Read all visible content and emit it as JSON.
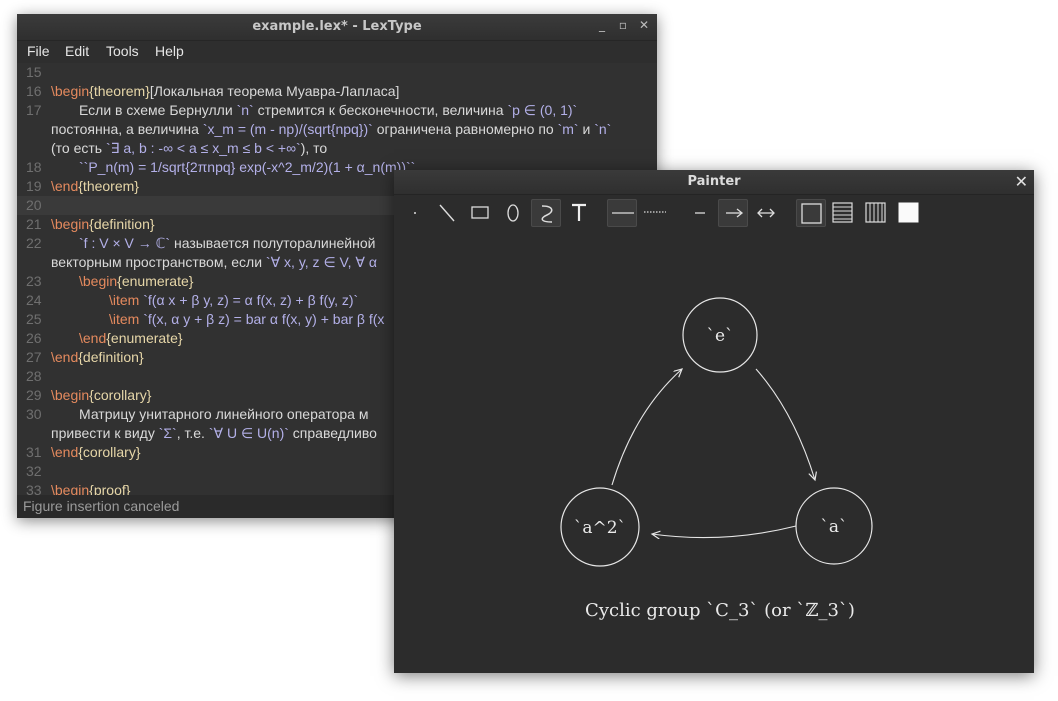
{
  "editor": {
    "title": "example.lex* - LexType",
    "menu": [
      "File",
      "Edit",
      "Tools",
      "Help"
    ],
    "status": "Figure insertion canceled",
    "lines": [
      {
        "no": "15",
        "segs": []
      },
      {
        "no": "16",
        "segs": [
          {
            "c": "kw-cmd",
            "t": "\\begin"
          },
          {
            "c": "kw-arg",
            "t": "{theorem}"
          },
          {
            "c": "",
            "t": "[Локальная теорема Муавра-Лапласа]"
          }
        ]
      },
      {
        "no": "17",
        "segs": [
          {
            "c": "",
            "t": "Если в схеме Бернулли "
          },
          {
            "c": "math",
            "t": "`n`"
          },
          {
            "c": "",
            "t": " стремится к бесконечности, величина "
          },
          {
            "c": "math",
            "t": "`p ∈ (0, 1)`"
          }
        ]
      },
      {
        "no": "",
        "segs": [
          {
            "c": "",
            "t": "постоянна, а величина "
          },
          {
            "c": "math",
            "t": "`x_m = (m - np)/(sqrt{npq})`"
          },
          {
            "c": "",
            "t": " ограничена равномерно по "
          },
          {
            "c": "math",
            "t": "`m`"
          },
          {
            "c": "",
            "t": " и "
          },
          {
            "c": "math",
            "t": "`n`"
          }
        ]
      },
      {
        "no": "",
        "segs": [
          {
            "c": "",
            "t": "(то есть "
          },
          {
            "c": "math",
            "t": "`∃ a, b : -∞ < a ≤ x_m ≤ b < +∞`"
          },
          {
            "c": "",
            "t": "), то"
          }
        ]
      },
      {
        "no": "18",
        "segs": [
          {
            "c": "math",
            "t": "``P_n(m) = 1/sqrt{2πnpq} exp(-x^2_m/2)(1 + α_n(m))``"
          }
        ]
      },
      {
        "no": "19",
        "segs": [
          {
            "c": "kw-cmd",
            "t": "\\end"
          },
          {
            "c": "kw-arg",
            "t": "{theorem}"
          }
        ]
      },
      {
        "no": "20",
        "segs": []
      },
      {
        "no": "21",
        "segs": [
          {
            "c": "kw-cmd",
            "t": "\\begin"
          },
          {
            "c": "kw-arg",
            "t": "{definition}"
          }
        ]
      },
      {
        "no": "22",
        "segs": [
          {
            "c": "math",
            "t": "`f : V × V → ℂ`"
          },
          {
            "c": "",
            "t": " называется полуторалинейной"
          }
        ]
      },
      {
        "no": "",
        "segs": [
          {
            "c": "",
            "t": "векторным пространством, если "
          },
          {
            "c": "math",
            "t": "`∀ x, y, z ∈ V, ∀ α"
          }
        ]
      },
      {
        "no": "23",
        "segs": [
          {
            "c": "kw-cmd",
            "t": "\\begin"
          },
          {
            "c": "kw-arg",
            "t": "{enumerate}"
          }
        ]
      },
      {
        "no": "24",
        "segs": [
          {
            "c": "kw-cmd",
            "t": "\\item"
          },
          {
            "c": "",
            "t": " "
          },
          {
            "c": "math",
            "t": "`f(α x + β y, z) = α f(x, z) + β f(y, z)`"
          }
        ]
      },
      {
        "no": "25",
        "segs": [
          {
            "c": "kw-cmd",
            "t": "\\item"
          },
          {
            "c": "",
            "t": " "
          },
          {
            "c": "math",
            "t": "`f(x, α y + β z) = bar α f(x, y) + bar β f(x"
          }
        ]
      },
      {
        "no": "26",
        "segs": [
          {
            "c": "kw-cmd",
            "t": "\\end"
          },
          {
            "c": "kw-arg",
            "t": "{enumerate}"
          }
        ]
      },
      {
        "no": "27",
        "segs": [
          {
            "c": "kw-cmd",
            "t": "\\end"
          },
          {
            "c": "kw-arg",
            "t": "{definition}"
          }
        ]
      },
      {
        "no": "28",
        "segs": []
      },
      {
        "no": "29",
        "segs": [
          {
            "c": "kw-cmd",
            "t": "\\begin"
          },
          {
            "c": "kw-arg",
            "t": "{corollary}"
          }
        ]
      },
      {
        "no": "30",
        "segs": [
          {
            "c": "",
            "t": "Матрицу унитарного линейного оператора м"
          }
        ]
      },
      {
        "no": "",
        "segs": [
          {
            "c": "",
            "t": "привести к виду "
          },
          {
            "c": "math",
            "t": "`Σ`"
          },
          {
            "c": "",
            "t": ", т.е. "
          },
          {
            "c": "math",
            "t": "`∀ U ∈ U(n)`"
          },
          {
            "c": "",
            "t": " справедливо"
          }
        ]
      },
      {
        "no": "31",
        "segs": [
          {
            "c": "kw-cmd",
            "t": "\\end"
          },
          {
            "c": "kw-arg",
            "t": "{corollary}"
          }
        ]
      },
      {
        "no": "32",
        "segs": []
      },
      {
        "no": "33",
        "segs": [
          {
            "c": "kw-cmd",
            "t": "\\begin"
          },
          {
            "c": "kw-arg",
            "t": "{proof}"
          }
        ]
      }
    ]
  },
  "painter": {
    "title": "Painter",
    "close_icon": "close-icon",
    "tools": [
      "point-tool-icon",
      "line-tool-icon",
      "rectangle-tool-icon",
      "ellipse-tool-icon",
      "curve-tool-icon",
      "text-tool-icon",
      "solid-line-style-icon",
      "dotted-line-style-icon",
      "no-arrow-icon",
      "single-arrow-icon",
      "double-arrow-icon",
      "no-fill-icon",
      "horizontal-hatch-fill-icon",
      "vertical-hatch-fill-icon",
      "solid-fill-icon"
    ],
    "nodes": {
      "e": "`e`",
      "a": "`a`",
      "a2": "`a^2`"
    },
    "caption": "Cyclic group `C_3` (or `ℤ_3`)"
  },
  "colors": {
    "editor_bg": "#313131",
    "command": "#e58a5e",
    "argument": "#e6d6a8",
    "math": "#b3b0e8",
    "current_line": "#3a3a3a"
  }
}
